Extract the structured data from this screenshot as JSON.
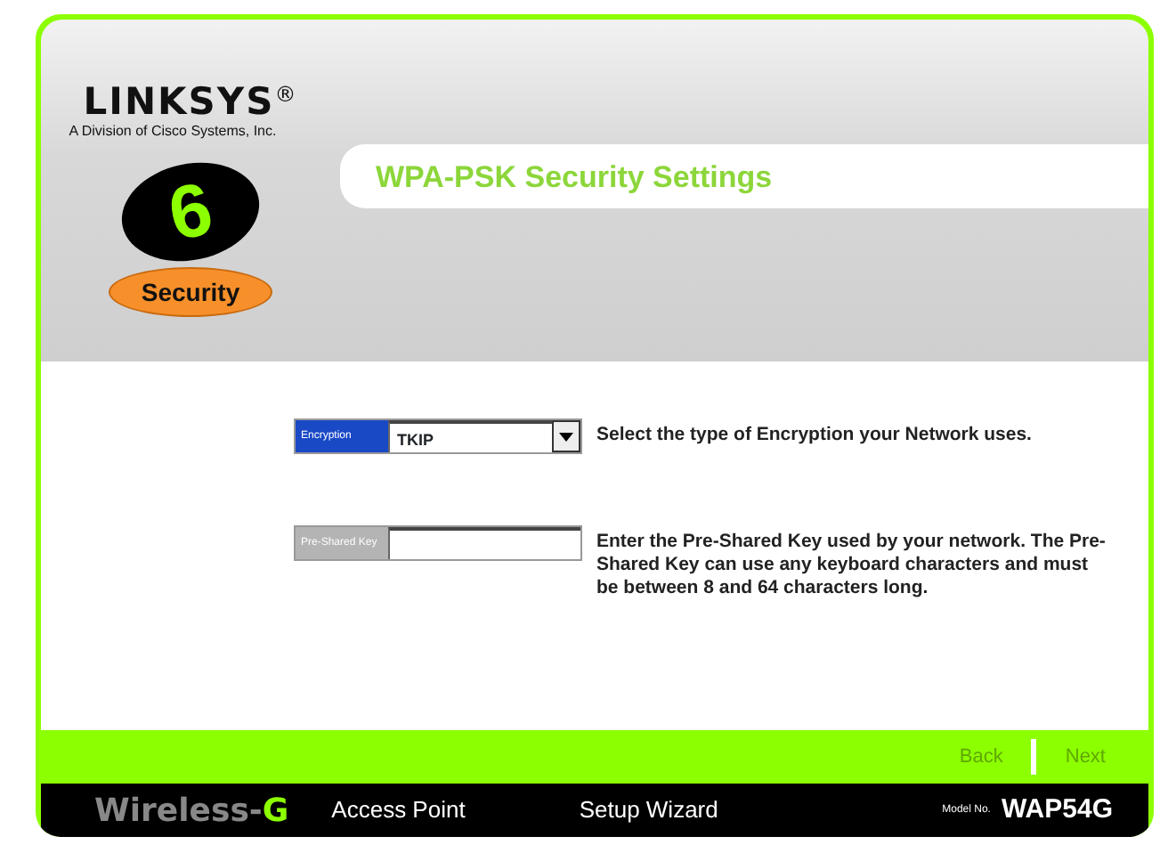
{
  "logo": {
    "brand": "LINKSYS",
    "mark": "®",
    "tagline": "A Division of Cisco Systems, Inc."
  },
  "step": {
    "number": "6",
    "name": "Security"
  },
  "title": "WPA-PSK Security Settings",
  "fields": [
    {
      "kind": "select",
      "label": "Encryption",
      "value": "TKIP",
      "help": "Select the type of Encryption your Network uses.",
      "disabled": false
    },
    {
      "kind": "text",
      "label": "Pre-Shared Key",
      "help": "Enter the Pre-Shared Key used by your network.  The Pre-Shared Key can use any keyboard characters and must be between 8 and **64** characters long.",
      "disabled": true
    }
  ],
  "nav_buttons": [
    {
      "label": "Back",
      "disabled": true
    },
    {
      "label": "Next",
      "disabled": true
    }
  ],
  "footer": {
    "product_prefix": "Wireless-",
    "product_suffix": "G",
    "device": "Access Point",
    "app": "Setup Wizard",
    "model_label": "Model No.",
    "model": "WAP54G"
  }
}
